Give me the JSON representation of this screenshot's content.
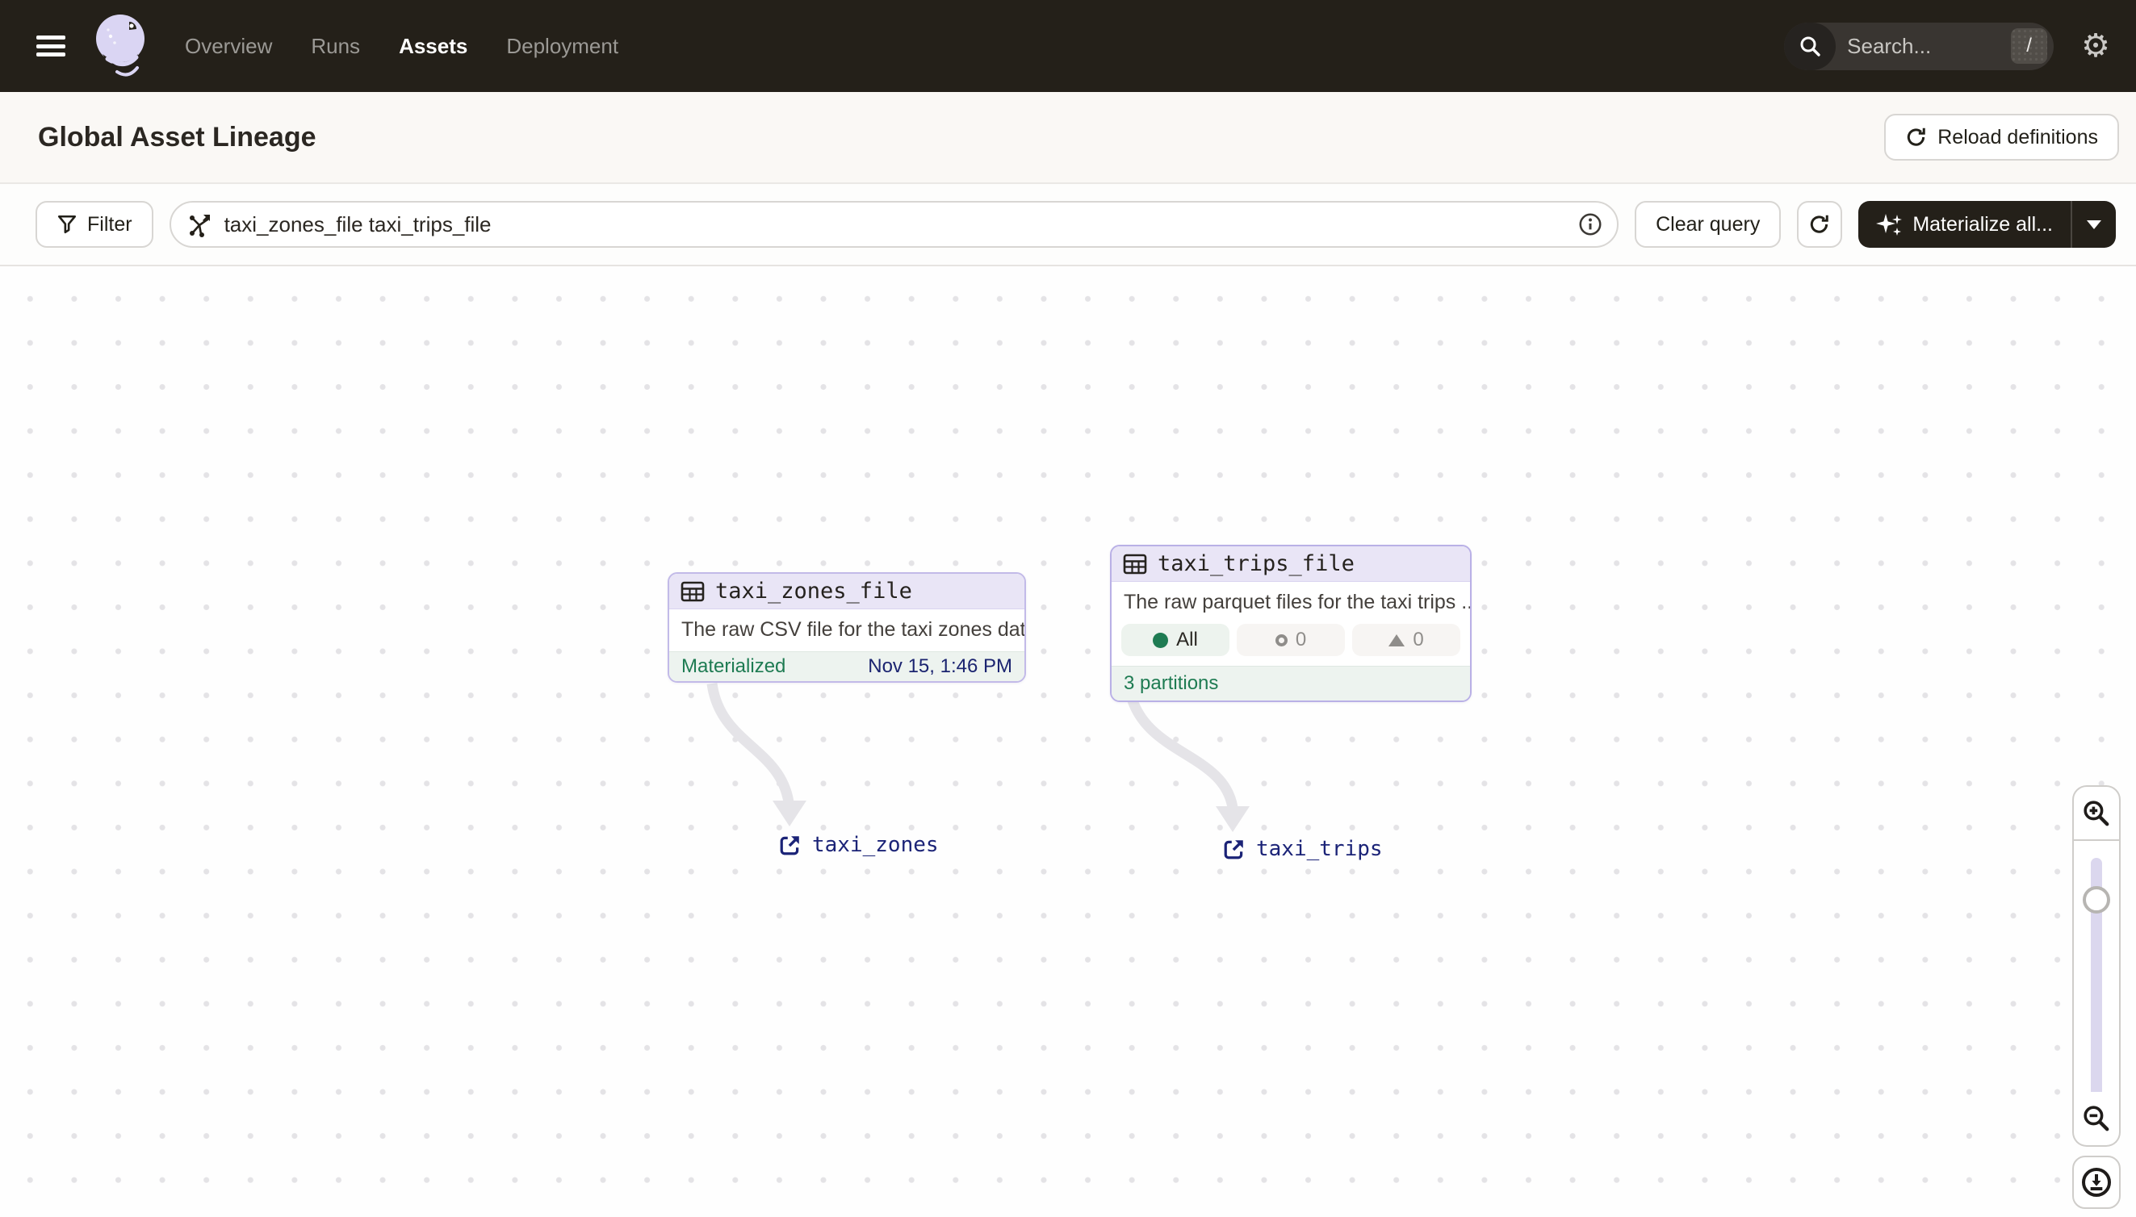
{
  "nav": {
    "items": [
      {
        "label": "Overview",
        "active": false
      },
      {
        "label": "Runs",
        "active": false
      },
      {
        "label": "Assets",
        "active": true
      },
      {
        "label": "Deployment",
        "active": false
      }
    ],
    "search_placeholder": "Search...",
    "search_shortcut": "/"
  },
  "page": {
    "title": "Global Asset Lineage",
    "reload_button": "Reload definitions"
  },
  "toolbar": {
    "filter_label": "Filter",
    "query_value": "taxi_zones_file taxi_trips_file",
    "clear_button": "Clear query",
    "materialize_button": "Materialize all..."
  },
  "graph": {
    "nodes": [
      {
        "title": "taxi_zones_file",
        "description": "The raw CSV file for the taxi zones dat...",
        "status_label": "Materialized",
        "status_time": "Nov 15, 1:46 PM"
      },
      {
        "title": "taxi_trips_file",
        "description": "The raw parquet files for the taxi trips ...",
        "pills": [
          {
            "label": "All",
            "icon": "filled-circle"
          },
          {
            "label": "0",
            "icon": "ring-circle"
          },
          {
            "label": "0",
            "icon": "triangle-up"
          }
        ],
        "footer": "3 partitions"
      }
    ],
    "external_links": [
      {
        "label": "taxi_zones"
      },
      {
        "label": "taxi_trips"
      }
    ]
  },
  "colors": {
    "header_bg": "#242019",
    "accent_lavender": "#DAD5F3",
    "node_border": "#C2BAE8",
    "node_header_bg": "#E9E5F6",
    "materialized_green": "#1E7B52",
    "timestamp_navy": "#1B2470",
    "link_navy": "#1B2377",
    "edge_gray": "#E5E4E8"
  }
}
